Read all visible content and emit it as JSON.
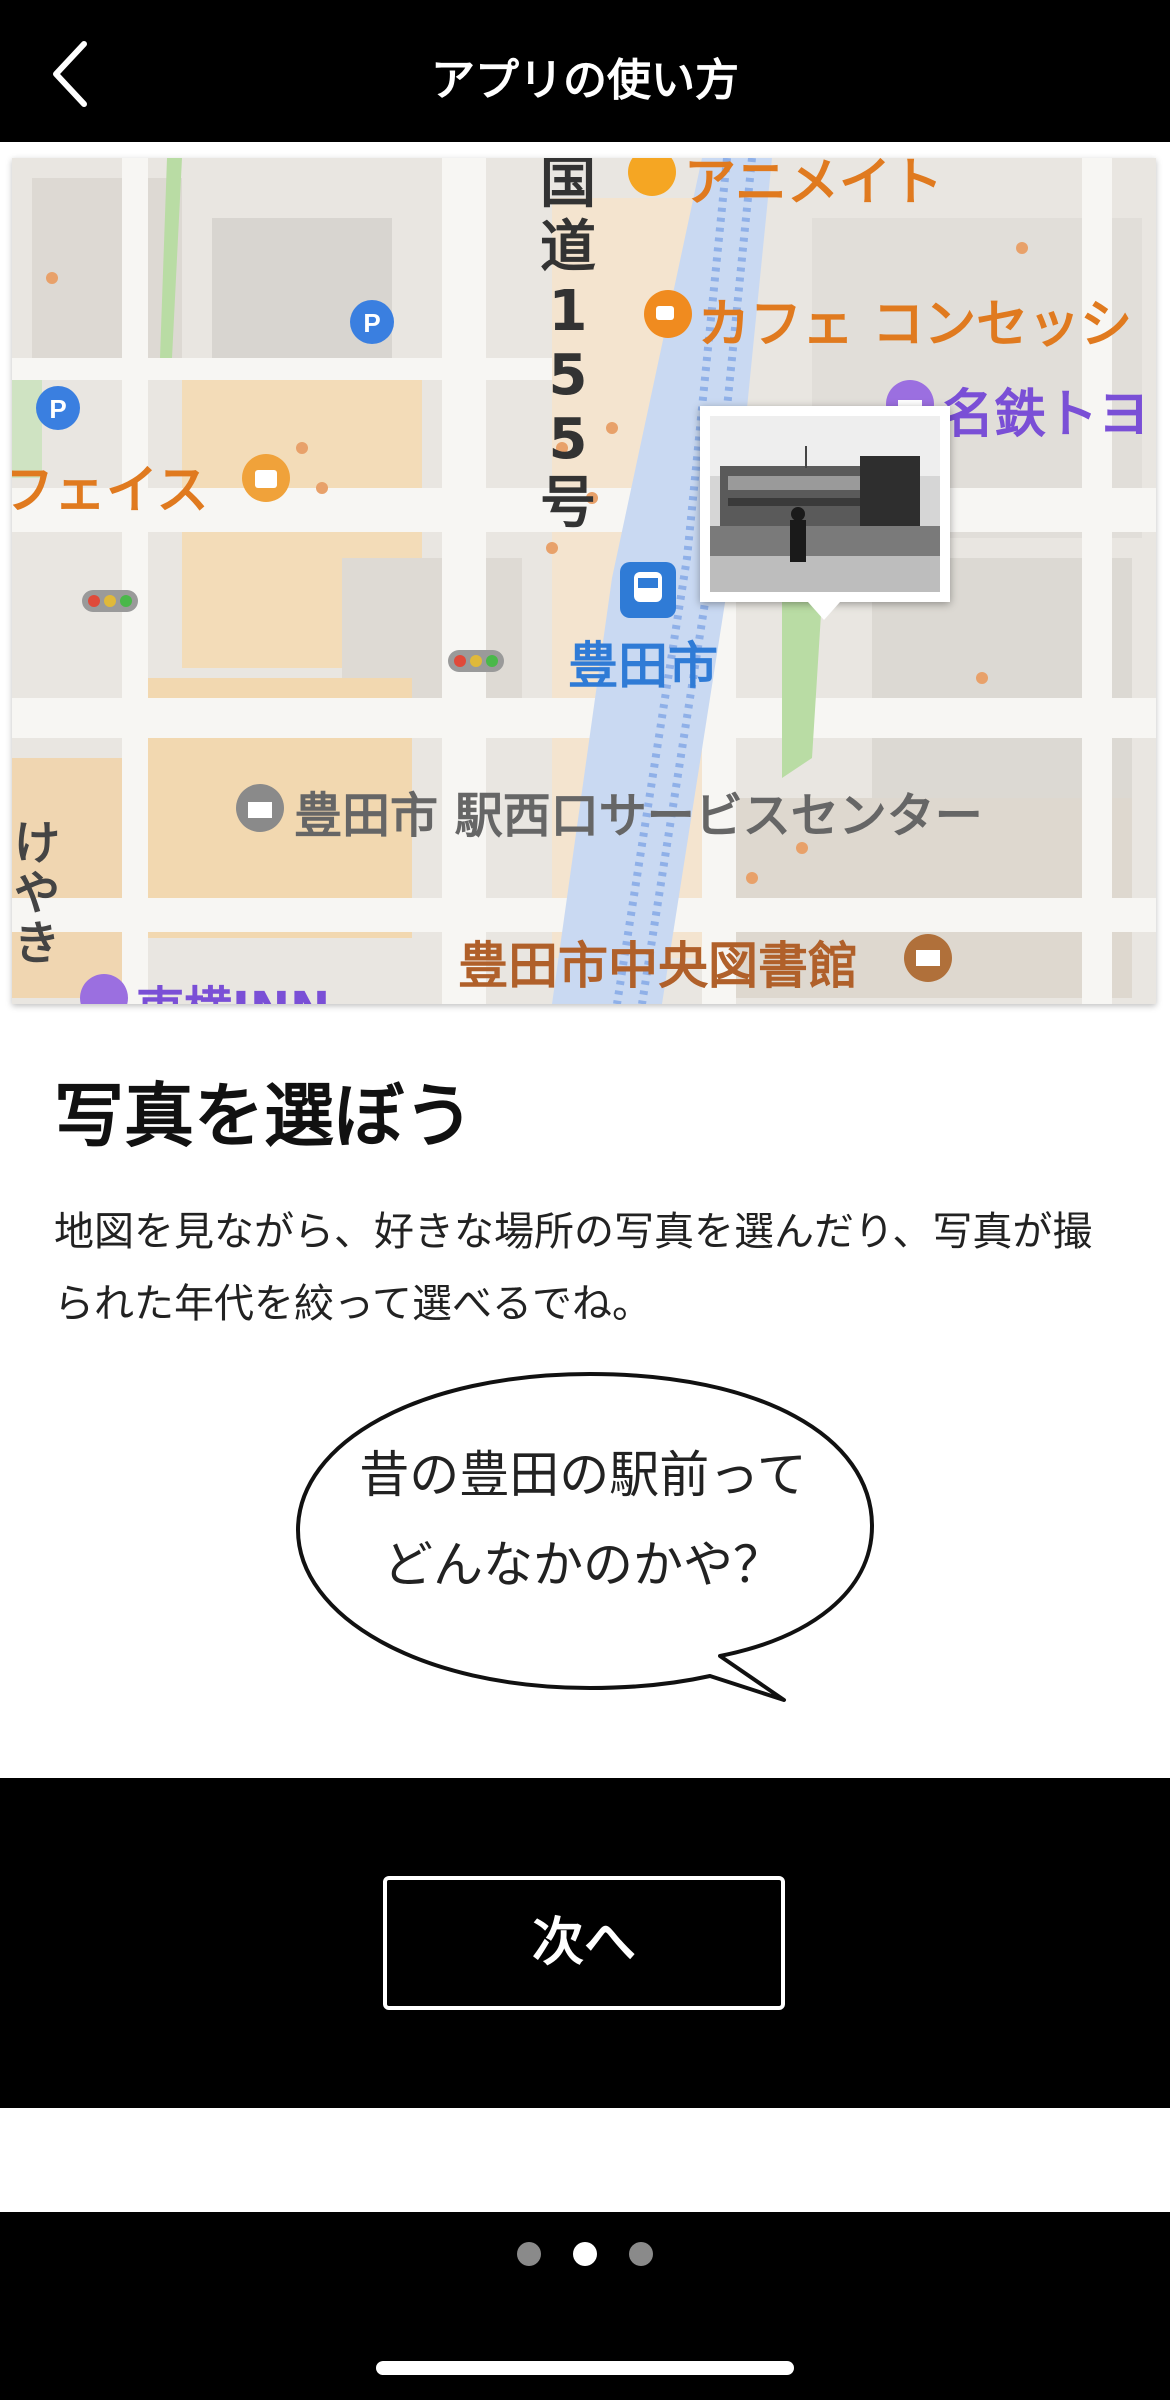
{
  "header": {
    "title": "アプリの使い方",
    "back_icon": "chevron-left-icon"
  },
  "map": {
    "labels": {
      "kokudo_char1": "国",
      "kokudo_char2": "道",
      "kokudo_char3": "1",
      "kokudo_char4": "5",
      "kokudo_char5": "5",
      "kokudo_char6": "号",
      "animate": "アニメイト",
      "cafe": "カフェ コンセッシ",
      "meitetsu": "名鉄トヨ",
      "face": "フェイス",
      "station": "豊田市",
      "service_center": "豊田市 駅西口サービスセンター",
      "library": "豊田市中央図書館",
      "keyaki1": "け",
      "keyaki2": "や",
      "keyaki3": "き",
      "hotel": "東横INN"
    },
    "colors": {
      "poi_orange": "#e07a1f",
      "transit_blue": "#2f7bd6",
      "purple": "#7a4fd6",
      "road_text": "#333333",
      "rail": "#8fb0e8"
    }
  },
  "content": {
    "heading": "写真を選ぼう",
    "description": "地図を見ながら、好きな場所の写真を選んだり、写真が撮られた年代を絞って選べるでね。",
    "bubble_line1": "昔の豊田の駅前って",
    "bubble_line2": "どんなかのかや？"
  },
  "actions": {
    "next_label": "次へ"
  },
  "pagination": {
    "total": 3,
    "current": 2
  }
}
